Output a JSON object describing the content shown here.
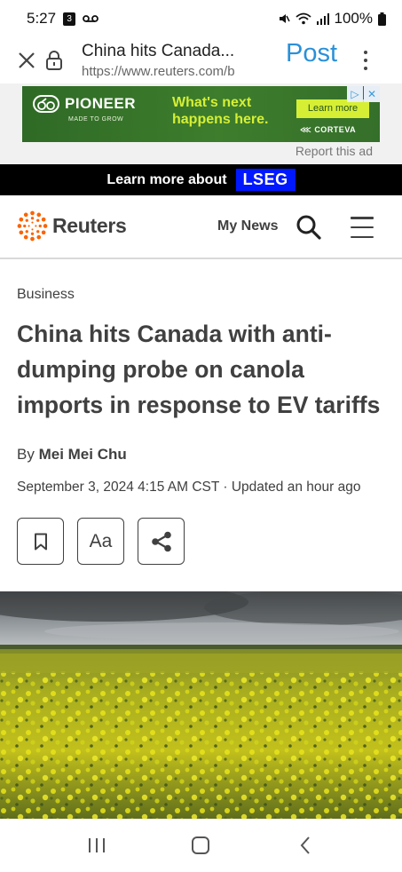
{
  "status_bar": {
    "time": "5:27",
    "battery": "100%",
    "icons": [
      "notification-badge-icon",
      "voicemail-icon",
      "mute-icon",
      "wifi-icon",
      "signal-icon",
      "battery-icon"
    ]
  },
  "browser": {
    "page_title": "China hits Canada...",
    "url": "https://www.reuters.com/b",
    "post_label": "Post"
  },
  "ad": {
    "brand": "PIONEER",
    "brand_tagline": "MADE TO GROW",
    "headline_line1": "What's next",
    "headline_line2": "happens here.",
    "cta": "Learn more",
    "sponsor": "CORTEVA",
    "report_label": "Report this ad"
  },
  "promo": {
    "text": "Learn more about",
    "logo": "LSEG"
  },
  "site_header": {
    "logo_text": "Reuters",
    "my_news": "My News"
  },
  "article": {
    "section": "Business",
    "headline": "China hits Canada with anti-dumping probe on canola imports in response to EV tariffs",
    "byline_prefix": "By",
    "author": "Mei Mei Chu",
    "dateline": "September 3, 2024 4:15 AM CST · Updated an hour ago",
    "font_button_label": "Aa"
  },
  "colors": {
    "post_link": "#2a90d8",
    "reuters_orange": "#fa6400",
    "lseg_blue": "#0018ff",
    "ad_green": "#3d7d2c",
    "ad_lime": "#d6ef34"
  }
}
